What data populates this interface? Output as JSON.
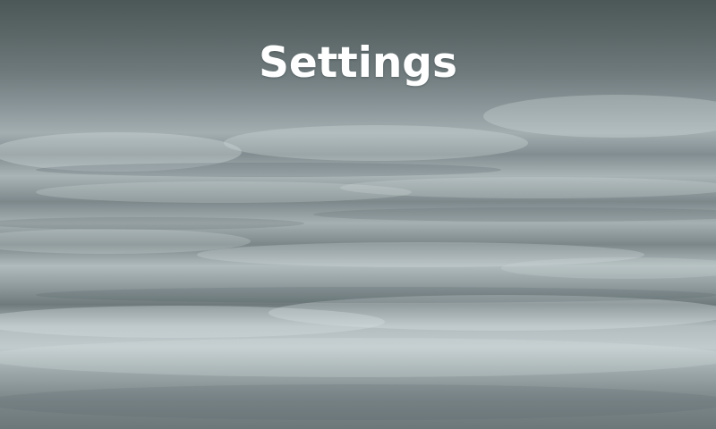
{
  "screen": {
    "title": "Settings"
  },
  "background": {
    "description_icon": "overcast-clouds-background",
    "colors": {
      "sky_dark": "#4c5758",
      "sky_mid": "#8a9699",
      "sky_light": "#c1cbcd",
      "title_text": "#ffffff"
    }
  }
}
